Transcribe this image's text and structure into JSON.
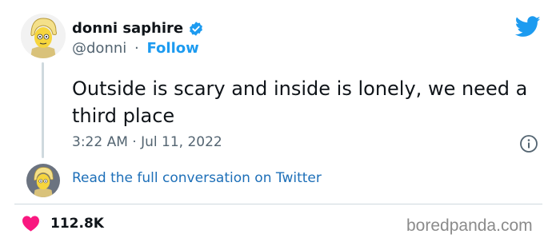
{
  "tweet": {
    "author": {
      "display_name": "donni saphire",
      "handle": "@donni",
      "verified_icon": "verified-badge-icon",
      "avatar_icon": "cartoon-avatar"
    },
    "separator": "·",
    "follow_label": "Follow",
    "text": "Outside is scary and inside is lonely, we need a third place",
    "timestamp": "3:22 AM · Jul 11, 2022",
    "read_conversation_label": "Read the full conversation on Twitter",
    "likes": "112.8K",
    "icons": {
      "brand": "twitter-bird-icon",
      "info": "info-icon",
      "like": "heart-icon"
    }
  },
  "watermark": "boredpanda.com",
  "colors": {
    "accent": "#1d9bf0",
    "link": "#1d6fb8",
    "heart": "#f91880",
    "muted": "#536471",
    "text": "#0f1419"
  }
}
